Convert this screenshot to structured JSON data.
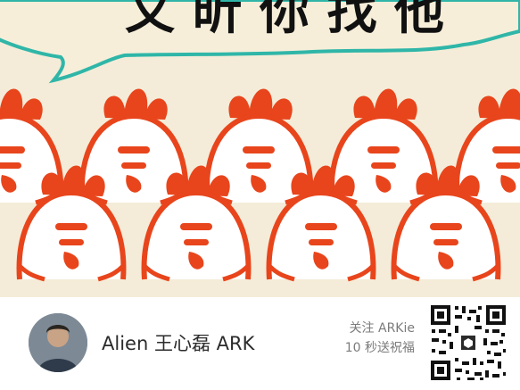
{
  "poster": {
    "headline": "又 昕 你 找 他",
    "colors": {
      "background": "#f4ecd8",
      "chicken": "#e8451c",
      "bubble_border": "#2fb6a8",
      "footer": "#ffffff"
    }
  },
  "footer": {
    "author_name": "Alien 王心磊 ARK",
    "follow_line": "关注 ARKie",
    "wish_line": "10 秒送祝福",
    "qr_icon": "qr-code-icon"
  }
}
